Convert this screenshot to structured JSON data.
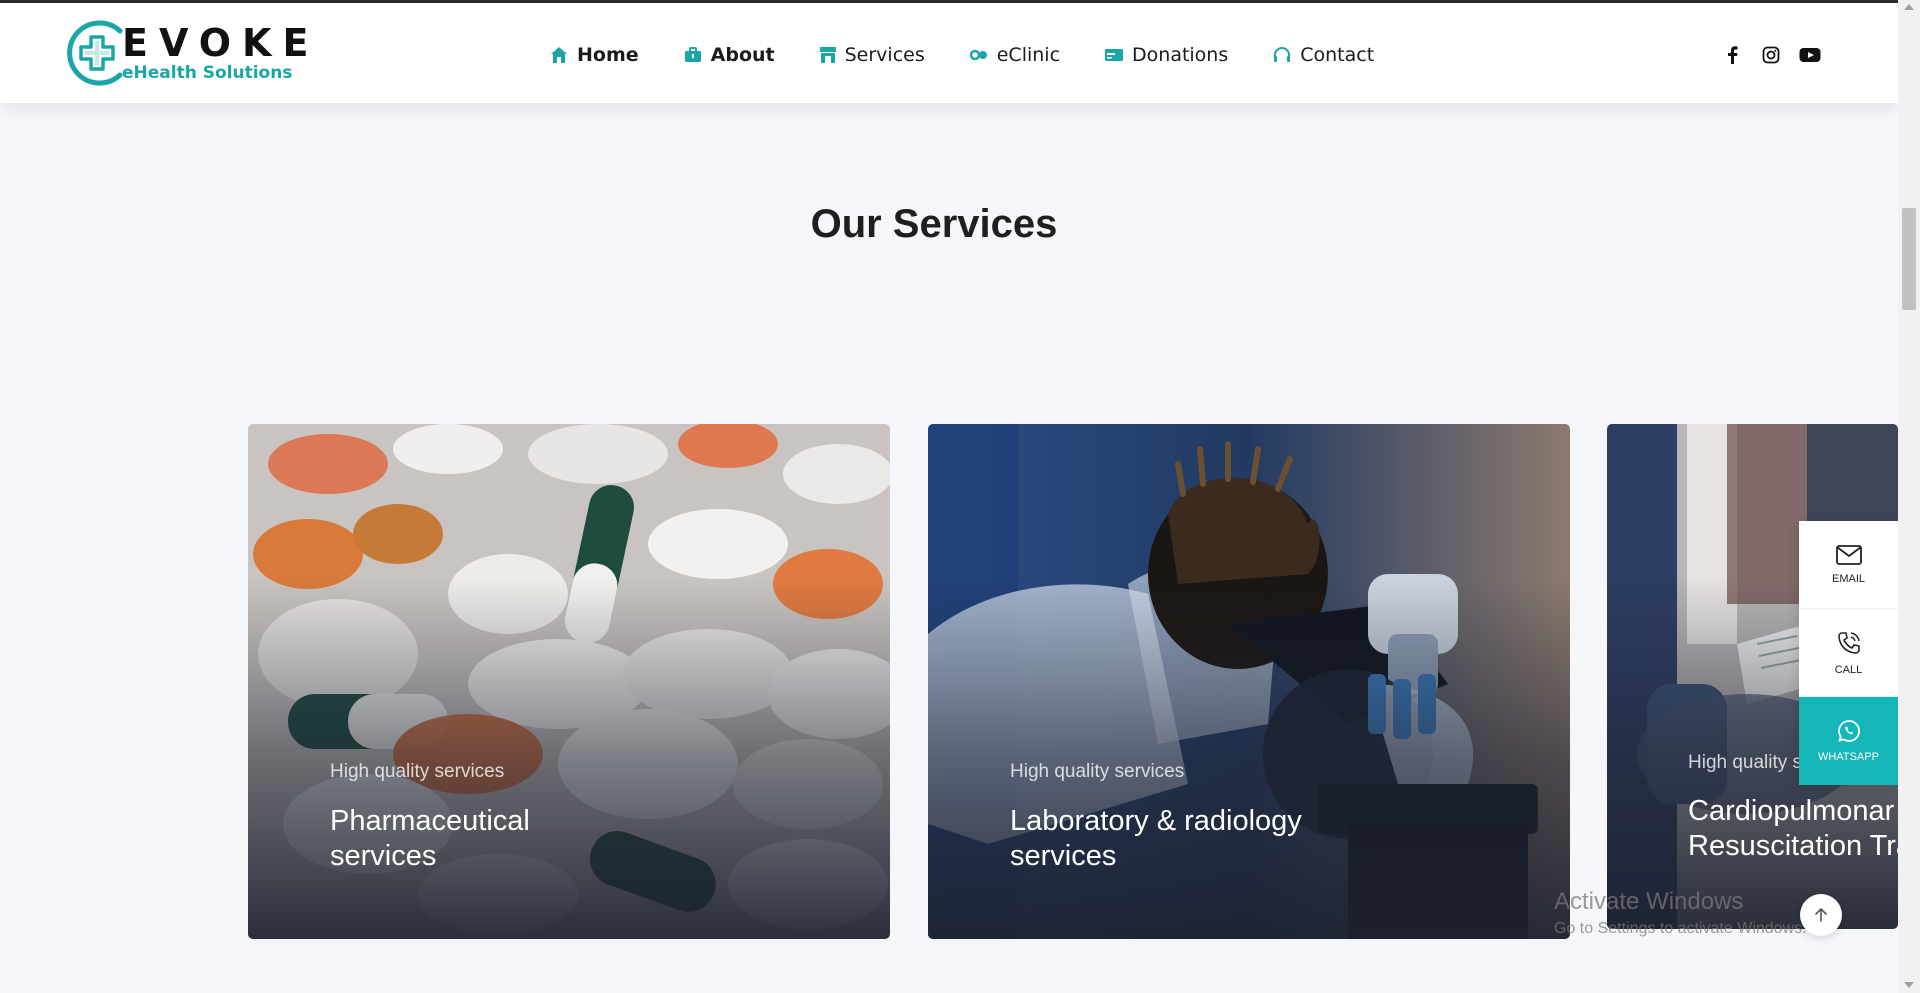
{
  "brand": {
    "name": "EVOKE",
    "tagline": "eHealth Solutions",
    "accent": "#1aa5a7"
  },
  "nav": {
    "items": [
      {
        "label": "Home",
        "icon": "home-icon"
      },
      {
        "label": "About",
        "icon": "briefcase-icon"
      },
      {
        "label": "Services",
        "icon": "store-icon"
      },
      {
        "label": "eClinic",
        "icon": "link-icon"
      },
      {
        "label": "Donations",
        "icon": "card-icon"
      },
      {
        "label": "Contact",
        "icon": "headset-icon"
      }
    ]
  },
  "socials": [
    "facebook-icon",
    "instagram-icon",
    "youtube-icon"
  ],
  "section": {
    "title": "Our Services"
  },
  "cards": [
    {
      "eyebrow": "High quality services",
      "title": "Pharmaceutical\nservices",
      "image": "pills-photo"
    },
    {
      "eyebrow": "High quality services",
      "title": "Laboratory & radiology\nservices",
      "image": "lab-microscope-photo"
    },
    {
      "eyebrow": "High quality s",
      "title": "Cardiopulmonar\nResuscitation Tra",
      "image": "cpr-training-photo"
    }
  ],
  "contact_widget": {
    "email": "EMAIL",
    "call": "CALL",
    "whatsapp": "WHATSAPP",
    "whatsapp_color": "#14b6b8"
  },
  "watermark": {
    "line1": "Activate Windows",
    "line2": "Go to Settings to activate Windows."
  }
}
